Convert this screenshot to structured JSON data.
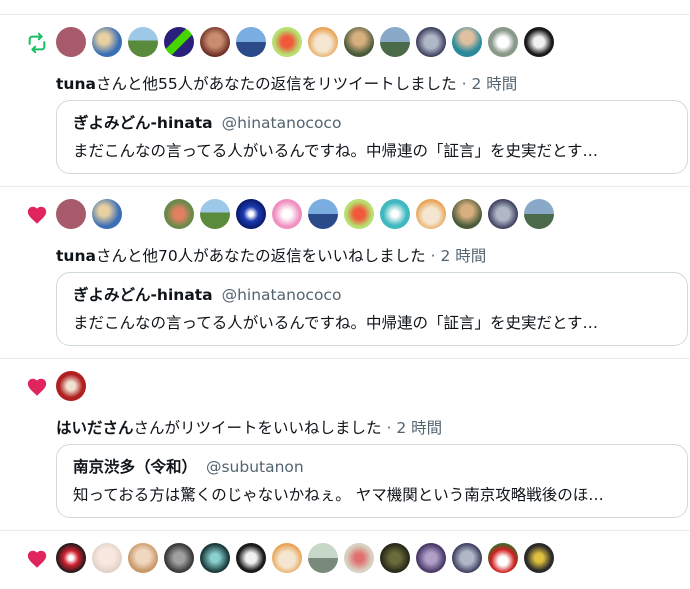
{
  "colors": {
    "retweet": "#17bf63",
    "like": "#e0245e",
    "border": "#e6ecf0",
    "muted": "#536471"
  },
  "notifications": [
    {
      "type_icon": "retweet-icon",
      "user": "tuna",
      "action": "さんと他55人があなたの返信をリツイートしました",
      "sep": "·",
      "time": "2 時間",
      "quote": {
        "name": "ぎよみどん-hinata",
        "handle": "@hinatanococo",
        "text": "まだこんなの言ってる人がいるんですね。中帰連の「証言」を史実だとす…"
      }
    },
    {
      "type_icon": "heart-icon",
      "user": "tuna",
      "action": "さんと他70人があなたの返信をいいねしました",
      "sep": "·",
      "time": "2 時間",
      "quote": {
        "name": "ぎよみどん-hinata",
        "handle": "@hinatanococo",
        "text": "まだこんなの言ってる人がいるんですね。中帰連の「証言」を史実だとす…"
      }
    },
    {
      "type_icon": "heart-icon",
      "user": "はいださん",
      "action": "さんがリツイートをいいねしました",
      "sep": "·",
      "time": "2 時間",
      "quote": {
        "name": "南京渋多（令和）",
        "handle": "@subutanon",
        "text": "知っておる方は驚くのじゃないかねぇ。 ヤマ機関という南京攻略戦後のほ…"
      }
    },
    {
      "type_icon": "heart-icon"
    }
  ]
}
